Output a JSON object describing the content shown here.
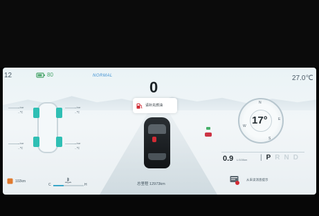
{
  "status_bar": {
    "time": "12",
    "state_of_charge": "80",
    "soc_suffix": "",
    "drive_mode": "NORMAL",
    "outside_temp": "27.0℃"
  },
  "speed": "0",
  "tires": {
    "front_left": {
      "pressure": "--bar",
      "temp": "--℃"
    },
    "front_right": {
      "pressure": "--bar",
      "temp": "--℃"
    },
    "rear_left": {
      "pressure": "--bar",
      "temp": "--℃"
    },
    "rear_right": {
      "pressure": "--bar",
      "temp": "--℃"
    }
  },
  "alert": {
    "text": "请补充燃油"
  },
  "compass": {
    "north": "N",
    "west": "W",
    "east": "E",
    "south": "S",
    "cabin_temp": "17°"
  },
  "range": {
    "value": "0.9",
    "unit": "L/100km"
  },
  "gear": {
    "positions": [
      "P",
      "R",
      "N",
      "D"
    ],
    "active": "P"
  },
  "bottom": {
    "remaining_range": "102km",
    "gauge_cold": "C",
    "gauge_hot": "H",
    "gauge_level": 0.35,
    "odometer": "总里程 12973km",
    "message": "从未读消息提示"
  },
  "colors": {
    "accent_green": "#49a56a",
    "tire_teal": "#2fbfb4",
    "warning_red": "#d12b34",
    "mode_blue": "#3b8fd1"
  }
}
